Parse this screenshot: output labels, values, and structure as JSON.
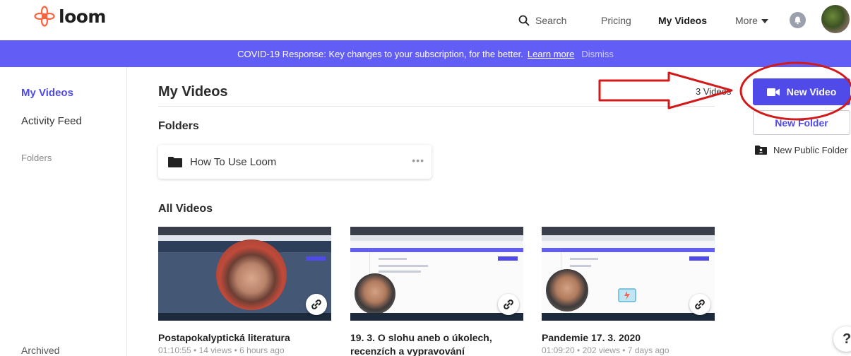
{
  "header": {
    "logo_text": "loom",
    "search_label": "Search",
    "pricing_label": "Pricing",
    "my_videos_label": "My Videos",
    "more_label": "More"
  },
  "banner": {
    "text": "COVID-19 Response: Key changes to your subscription, for the better.",
    "learn_more": "Learn more",
    "dismiss": "Dismiss"
  },
  "sidebar": {
    "items": [
      {
        "label": "My Videos"
      },
      {
        "label": "Activity Feed"
      },
      {
        "label": "Folders"
      },
      {
        "label": "Archived"
      }
    ]
  },
  "main": {
    "title": "My Videos",
    "video_count": "3 Videos",
    "folders_heading": "Folders",
    "folder": {
      "name": "How To Use Loom",
      "menu": "•••"
    },
    "all_videos_heading": "All Videos",
    "videos": [
      {
        "title": "Postapokalyptická literatura",
        "meta": "01:10:55 • 14 views • 6 hours ago"
      },
      {
        "title": "19. 3. O slohu aneb o úkolech,",
        "meta": "recenzích a vypravování"
      },
      {
        "title": "Pandemie 17. 3. 2020",
        "meta": "01:09:20 • 202 views • 7 days ago"
      }
    ]
  },
  "actions": {
    "new_video": "New Video",
    "new_folder": "New Folder",
    "new_public_folder": "New Public Folder"
  },
  "help": {
    "label": "?"
  },
  "colors": {
    "brand": "#625df5",
    "primary_button": "#4f4ae8",
    "annotation": "#d11a1a",
    "logo": "#ff623e"
  },
  "icons": {
    "logo": "loom-logo-icon",
    "search": "search-icon",
    "caret": "chevron-down-icon",
    "bell": "bell-icon",
    "folder": "folder-icon",
    "camera": "camera-icon",
    "public_folder": "public-folder-icon",
    "link": "link-icon"
  }
}
